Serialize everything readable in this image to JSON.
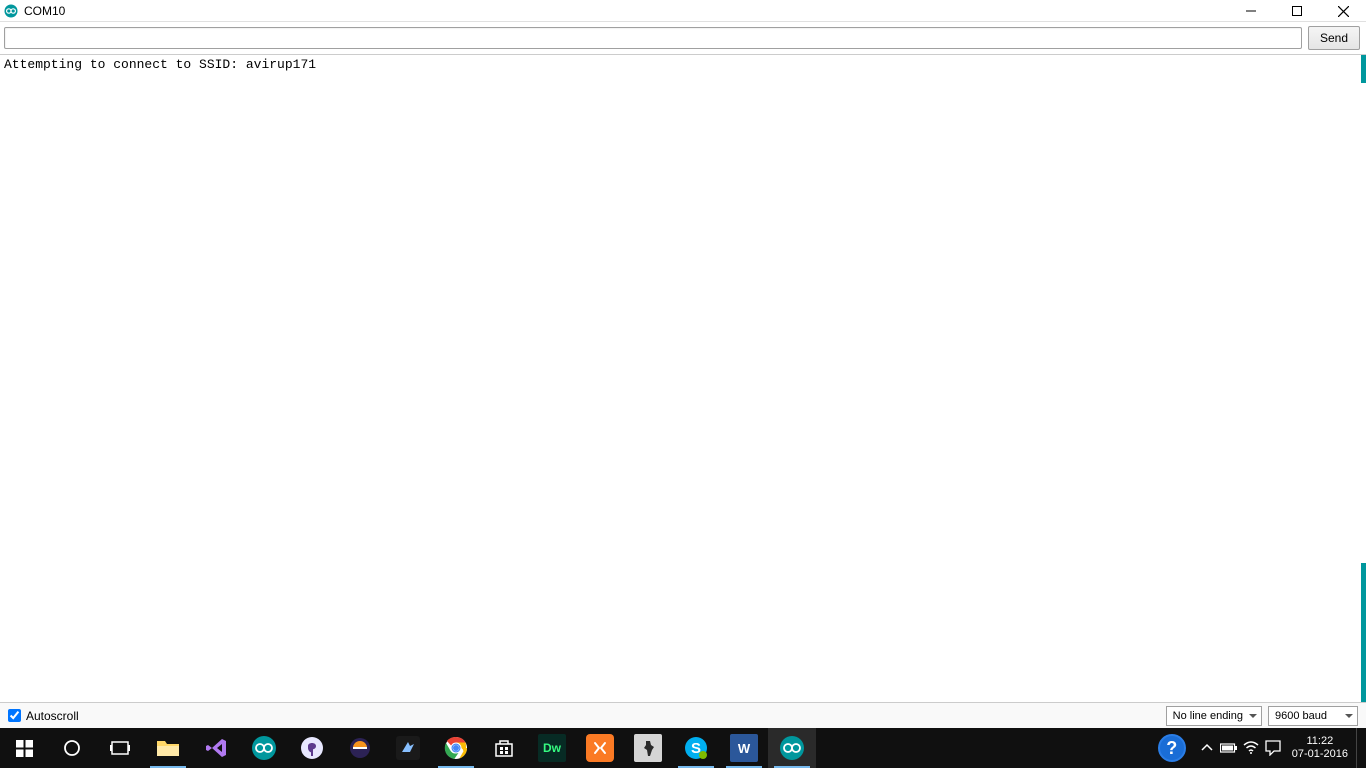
{
  "titlebar": {
    "title": "COM10"
  },
  "input_row": {
    "serial_input_value": "",
    "send_label": "Send"
  },
  "output": {
    "text": "Attempting to connect to SSID: avirup171"
  },
  "bottom_bar": {
    "autoscroll_label": "Autoscroll",
    "autoscroll_checked": true,
    "line_ending_selected": "No line ending",
    "baud_selected": "9600 baud"
  },
  "taskbar": {
    "help_symbol": "?",
    "clock_time": "11:22",
    "clock_date": "07-01-2016"
  }
}
